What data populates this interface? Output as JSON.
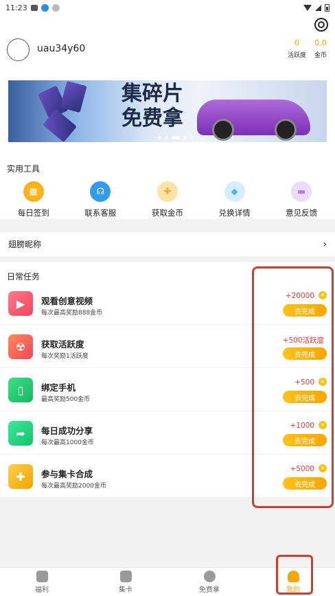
{
  "status_bar": {
    "time": "11:23"
  },
  "profile": {
    "username": "uau34y60",
    "stats": [
      {
        "value": "0",
        "label": "活跃度"
      },
      {
        "value": "0.0",
        "label": "金币"
      }
    ]
  },
  "banner": {
    "title_line1": "集碎片",
    "title_line2": "免费拿"
  },
  "tools": {
    "title": "实用工具",
    "items": [
      {
        "label": "每日签到",
        "icon": "calendar-icon",
        "color": "#f7b21c"
      },
      {
        "label": "联系客服",
        "icon": "headset-icon",
        "color": "#2f9cf0"
      },
      {
        "label": "获取金币",
        "icon": "gift-icon",
        "color": "#fcd98c"
      },
      {
        "label": "兑换详情",
        "icon": "diamond-icon",
        "color": "#46b8f2"
      },
      {
        "label": "意见反馈",
        "icon": "card-icon",
        "color": "#b57ae8"
      }
    ]
  },
  "nickname": {
    "label": "翅膀昵称",
    "chevron": "›"
  },
  "tasks": {
    "title": "日常任务",
    "button_label": "去完成",
    "items": [
      {
        "name": "观看创意视频",
        "desc": "每次最高奖励888金币",
        "reward": "+20000",
        "icon": "play-icon",
        "color": "#f2546a"
      },
      {
        "name": "获取活跃度",
        "desc": "每次奖励1活跃度",
        "reward": "+500活跃度",
        "icon": "radiation-icon",
        "color": "#f36a4a"
      },
      {
        "name": "绑定手机",
        "desc": "最高奖励500金币",
        "reward": "+500",
        "icon": "phone-icon",
        "color": "#1ec96a"
      },
      {
        "name": "每日成功分享",
        "desc": "每次最高1000金币",
        "reward": "+1000",
        "icon": "share-icon",
        "color": "#1fcf78"
      },
      {
        "name": "参与集卡合成",
        "desc": "每次最高奖励2000金币",
        "reward": "+5000",
        "icon": "puzzle-icon",
        "color": "#f7b21c"
      }
    ]
  },
  "tabbar": {
    "items": [
      {
        "label": "福利",
        "icon": "gift-icon"
      },
      {
        "label": "集卡",
        "icon": "cards-icon"
      },
      {
        "label": "免费拿",
        "icon": "free-icon"
      },
      {
        "label": "我的",
        "icon": "user-icon"
      }
    ]
  }
}
